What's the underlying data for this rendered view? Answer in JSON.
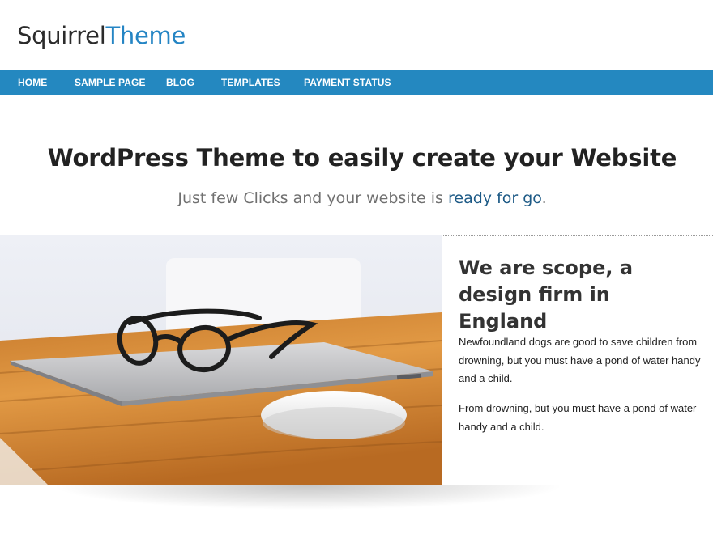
{
  "site": {
    "logo_part1": "Squirrel",
    "logo_part2": "Theme"
  },
  "nav": {
    "items": [
      {
        "label": "HOME"
      },
      {
        "label": "SAMPLE PAGE"
      },
      {
        "label": "BLOG"
      },
      {
        "label": "TEMPLATES"
      },
      {
        "label": "PAYMENT STATUS"
      }
    ]
  },
  "hero": {
    "title": "WordPress Theme to easily create your Website",
    "subtitle_plain": "Just few Clicks and your website is ",
    "subtitle_accent": "ready for go",
    "subtitle_end": "."
  },
  "about": {
    "title": "We are scope, a design firm in England",
    "paragraph1": "Newfoundland dogs are good to save children from drowning, but you must have a pond of water handy and a child.",
    "paragraph2": "From drowning, but you must have a pond of water handy and a child."
  },
  "colors": {
    "brand_blue": "#2585c4",
    "nav_bg": "#2488c0",
    "accent_text": "#1d5a86"
  },
  "icons": {
    "hero_image": "laptop-glasses-mouse-photo"
  }
}
